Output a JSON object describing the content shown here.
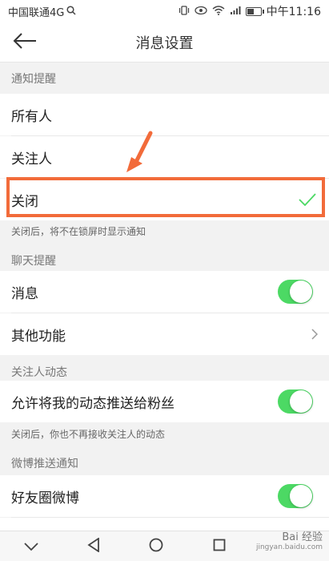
{
  "status_bar": {
    "carrier": "中国联通4G",
    "time": "中午11:16",
    "battery_level": 0.55,
    "icons": [
      "search-icon",
      "vibrate-icon",
      "eye-icon",
      "wifi-icon",
      "signal-icon",
      "battery-icon"
    ]
  },
  "nav": {
    "title": "消息设置",
    "back_icon": "arrow-left-icon"
  },
  "sections": {
    "notify": {
      "header": "通知提醒",
      "options": [
        "所有人",
        "关注人",
        "关闭"
      ],
      "selected": "关闭",
      "note": "关闭后，将不在锁屏时显示通知"
    },
    "chat": {
      "header": "聊天提醒",
      "message_label": "消息",
      "message_on": true,
      "other_label": "其他功能"
    },
    "followed": {
      "header": "关注人动态",
      "push_label": "允许将我的动态推送给粉丝",
      "push_on": true,
      "note": "关闭后，你也不再接收关注人的动态"
    },
    "weibo_push": {
      "header": "微博推送通知",
      "friends_label": "好友圈微博",
      "friends_on": true
    }
  },
  "colors": {
    "toggle_on": "#4cd964",
    "check": "#4cd964",
    "highlight": "#f26b3a"
  },
  "watermark": {
    "brand": "Bai 经验",
    "site": "jingyan.baidu.com"
  }
}
